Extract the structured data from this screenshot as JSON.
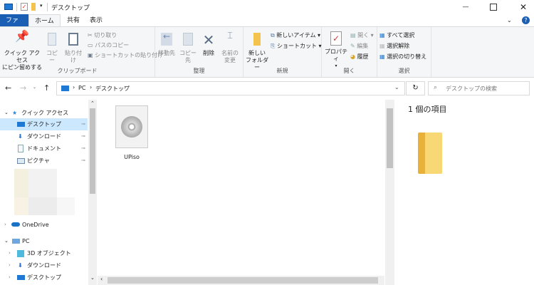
{
  "window": {
    "title": "デスクトップ"
  },
  "tabs": [
    "ファイル",
    "ホーム",
    "共有",
    "表示"
  ],
  "ribbon": {
    "clipboard": {
      "label": "クリップボード",
      "pin": "クイック アクセス\nにピン留めする",
      "copy": "コピー",
      "paste": "貼り付け",
      "cut": "切り取り",
      "copy_path": "パスのコピー",
      "paste_shortcut": "ショートカットの貼り付け"
    },
    "organize": {
      "label": "整理",
      "move": "移動先",
      "copyto": "コピー先",
      "delete": "削除",
      "rename": "名前の\n変更"
    },
    "new": {
      "label": "新規",
      "new_folder": "新しい\nフォルダー",
      "new_item": "新しいアイテム ▾",
      "shortcut": "ショートカット ▾"
    },
    "open": {
      "label": "開く",
      "properties": "プロパティ",
      "open": "開く ▾",
      "edit": "編集",
      "history": "履歴"
    },
    "select": {
      "label": "選択",
      "all": "すべて選択",
      "none": "選択解除",
      "invert": "選択の切り替え"
    }
  },
  "address": {
    "path": [
      "PC",
      "デスクトップ"
    ],
    "search_placeholder": "デスクトップの検索"
  },
  "nav": {
    "quick_access": "クイック アクセス",
    "quick_items": [
      "デスクトップ",
      "ダウンロード",
      "ドキュメント",
      "ピクチャ"
    ],
    "onedrive": "OneDrive",
    "pc": "PC",
    "pc_items": [
      "3D オブジェクト",
      "ダウンロード",
      "デスクトップ"
    ]
  },
  "files": [
    {
      "name": "UPiso",
      "icon": "disc-image-icon"
    }
  ],
  "preview": {
    "count_text": "1 個の項目"
  },
  "colors": {
    "accent": "#1b5fb4",
    "selected": "#cce8ff"
  }
}
